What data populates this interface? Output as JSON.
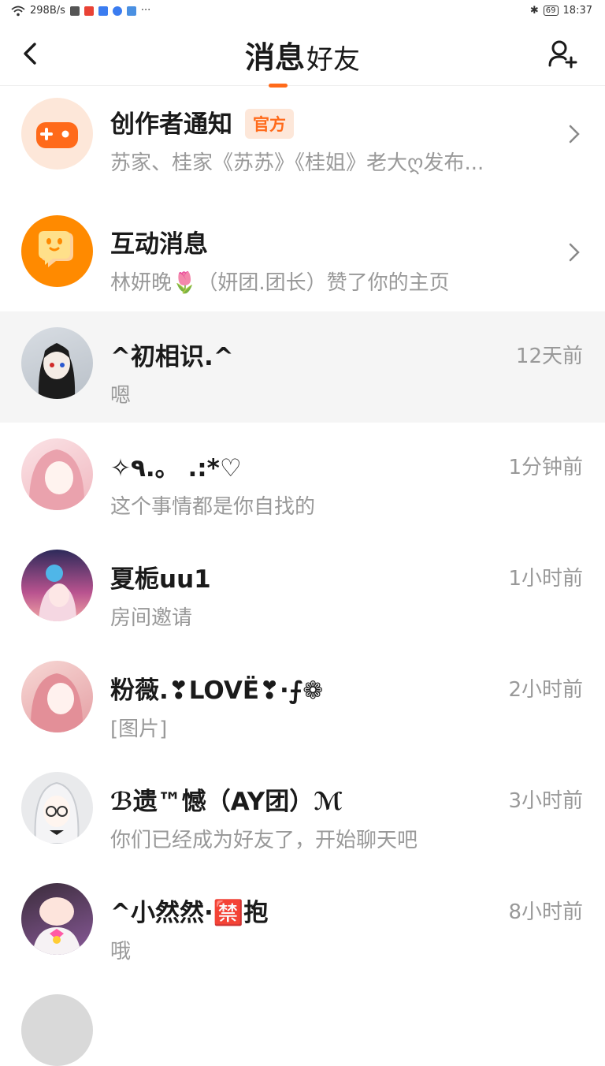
{
  "status_bar": {
    "net_speed": "298B/s",
    "battery": "69",
    "time": "18:37"
  },
  "header": {
    "tab_messages": "消息",
    "tab_friends": "好友"
  },
  "colors": {
    "accent": "#ff6a1a",
    "badge_bg": "#fde7d9"
  },
  "rows": [
    {
      "title": "创作者通知",
      "badge": "官方",
      "subtitle": "苏家、桂家《苏苏》《桂姐》老大ღ发布...",
      "icon": "gamepad-icon"
    },
    {
      "title": "互动消息",
      "subtitle": "林妍晚🌷（妍团.团长）赞了你的主页",
      "icon": "chat-bubble-icon"
    },
    {
      "title": "^初相识.^",
      "subtitle": "嗯",
      "time": "12天前"
    },
    {
      "title": "✧٩.。 .:*♡",
      "subtitle": "这个事情都是你自找的",
      "time": "1分钟前"
    },
    {
      "title": "夏栀uu1",
      "subtitle": "房间邀请",
      "time": "1小时前"
    },
    {
      "title": "粉薇.❣LOVË❣·⨍❁",
      "subtitle": "[图片]",
      "time": "2小时前"
    },
    {
      "title": "ℬ遗™憾（AY团）ℳ",
      "subtitle": "你们已经成为好友了，开始聊天吧",
      "time": "3小时前"
    },
    {
      "title": "^小然然·🈲抱",
      "subtitle": "哦",
      "time": "8小时前"
    }
  ]
}
